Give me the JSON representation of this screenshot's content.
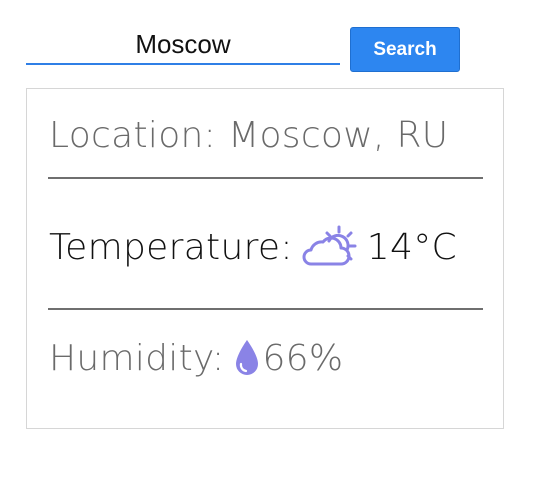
{
  "search": {
    "query": "Moscow",
    "button_label": "Search"
  },
  "card": {
    "location_label": "Location:",
    "location_value": "Moscow, RU",
    "temperature_label": "Temperature:",
    "temperature_value": "14",
    "temperature_unit": "°C",
    "humidity_label": "Humidity:",
    "humidity_value": "66",
    "humidity_unit": "%",
    "weather_icon": "partly-cloudy-icon",
    "humidity_icon": "water-drop-icon"
  },
  "colors": {
    "accent": "#2d86f0",
    "icon": "#8a83e6",
    "divider": "#6f6f6f",
    "muted_text": "#6a6a6a"
  }
}
